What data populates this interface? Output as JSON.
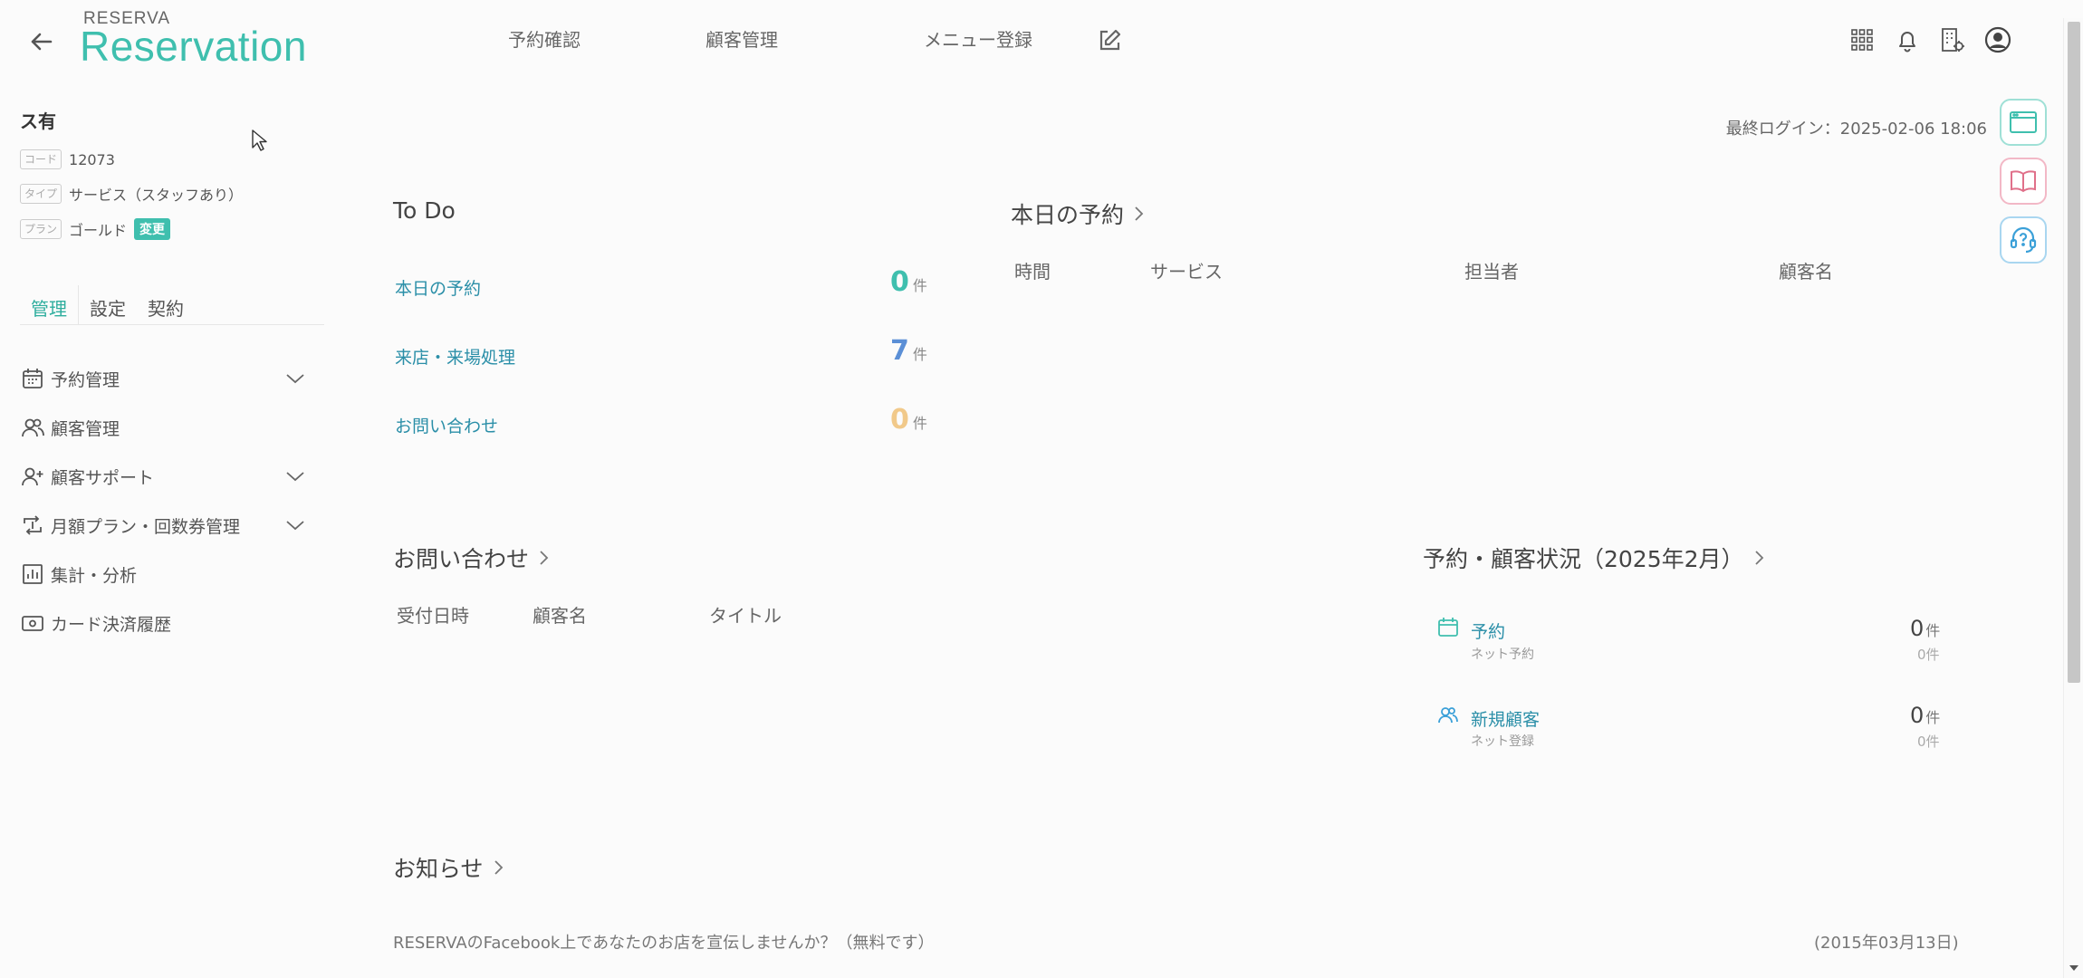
{
  "header": {
    "logo_top": "RESERVA",
    "logo_main": "Reservation",
    "nav": [
      {
        "label": "予約確認"
      },
      {
        "label": "顧客管理"
      },
      {
        "label": "メニュー登録"
      }
    ],
    "icons": [
      "back-arrow-icon",
      "edit-icon",
      "grid-icon",
      "bell-icon",
      "building-icon",
      "user-circle-icon"
    ]
  },
  "sidebar": {
    "shop_name": "ス有",
    "code_tag": "コード",
    "code_value": "12073",
    "type_tag": "タイプ",
    "type_value": "サービス（スタッフあり）",
    "plan_tag": "プラン",
    "plan_value": "ゴールド",
    "plan_change": "変更",
    "tabs": [
      {
        "label": "管理",
        "active": true
      },
      {
        "label": "設定",
        "active": false
      },
      {
        "label": "契約",
        "active": false
      }
    ],
    "menu": [
      {
        "label": "予約管理",
        "icon": "calendar-icon",
        "expandable": true
      },
      {
        "label": "顧客管理",
        "icon": "users-icon",
        "expandable": false
      },
      {
        "label": "顧客サポート",
        "icon": "user-plus-icon",
        "expandable": true
      },
      {
        "label": "月額プラン・回数券管理",
        "icon": "repeat-icon",
        "expandable": true
      },
      {
        "label": "集計・分析",
        "icon": "bar-chart-icon",
        "expandable": false
      },
      {
        "label": "カード決済履歴",
        "icon": "card-icon",
        "expandable": false
      }
    ]
  },
  "main": {
    "last_login": "最終ログイン：2025-02-06 18:06",
    "todo": {
      "title": "To Do",
      "unit": "件",
      "items": [
        {
          "label": "本日の予約",
          "count": "0",
          "color": "#3fbfae"
        },
        {
          "label": "来店・来場処理",
          "count": "7",
          "color": "#5b8fd6"
        },
        {
          "label": "お問い合わせ",
          "count": "0",
          "color": "#f1c98a"
        }
      ]
    },
    "today": {
      "title": "本日の予約",
      "columns": [
        "時間",
        "サービス",
        "担当者",
        "顧客名"
      ]
    },
    "inquiry": {
      "title": "お問い合わせ",
      "columns": [
        "受付日時",
        "顧客名",
        "タイトル"
      ]
    },
    "status": {
      "title": "予約・顧客状況（2025年2月）",
      "unit": "件",
      "rows": [
        {
          "label": "予約",
          "sub": "ネット予約",
          "count": "0",
          "sub_count": "0件",
          "icon": "calendar-icon"
        },
        {
          "label": "新規顧客",
          "sub": "ネット登録",
          "count": "0",
          "sub_count": "0件",
          "icon": "users-icon"
        }
      ]
    },
    "news": {
      "title": "お知らせ",
      "items": [
        {
          "text": "RESERVAのFacebook上であなたのお店を宣伝しませんか？（無料です）",
          "date": "(2015年03月13日)"
        }
      ]
    }
  },
  "floating": [
    {
      "icon": "browser-window-icon",
      "color": "#3fbfae"
    },
    {
      "icon": "book-icon",
      "color": "#e0708a"
    },
    {
      "icon": "support-headset-icon",
      "color": "#3ba0d8"
    }
  ]
}
